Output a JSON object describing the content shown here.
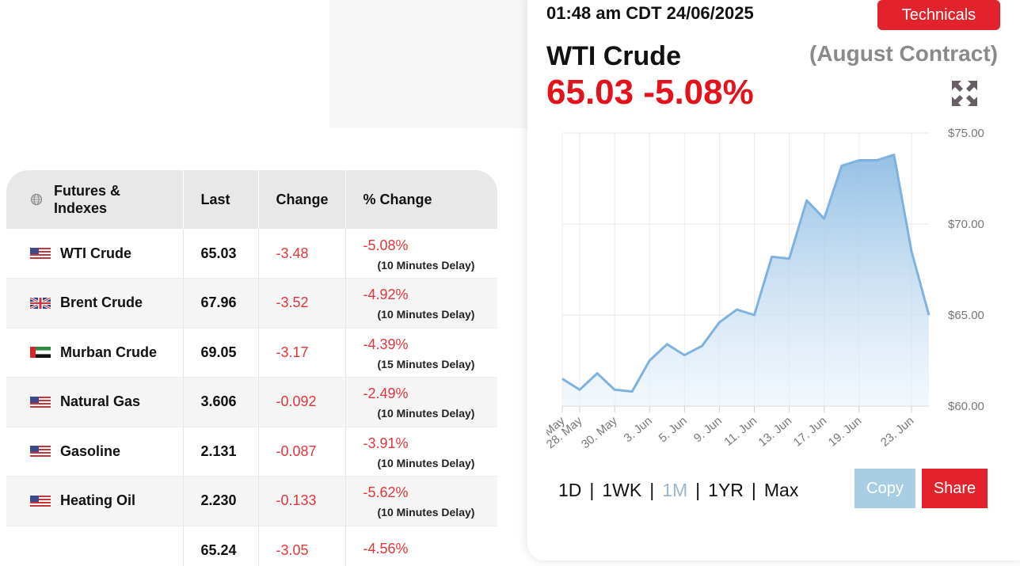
{
  "table": {
    "headers": {
      "name": "Futures & Indexes",
      "last": "Last",
      "change": "Change",
      "pct": "% Change"
    },
    "rows": [
      {
        "flag": "us",
        "name": "WTI Crude",
        "last": "65.03",
        "change": "-3.48",
        "pct": "-5.08%",
        "delay": "(10 Minutes Delay)"
      },
      {
        "flag": "uk",
        "name": "Brent Crude",
        "last": "67.96",
        "change": "-3.52",
        "pct": "-4.92%",
        "delay": "(10 Minutes Delay)"
      },
      {
        "flag": "ae",
        "name": "Murban Crude",
        "last": "69.05",
        "change": "-3.17",
        "pct": "-4.39%",
        "delay": "(15 Minutes Delay)"
      },
      {
        "flag": "us",
        "name": "Natural Gas",
        "last": "3.606",
        "change": "-0.092",
        "pct": "-2.49%",
        "delay": "(10 Minutes Delay)"
      },
      {
        "flag": "us",
        "name": "Gasoline",
        "last": "2.131",
        "change": "-0.087",
        "pct": "-3.91%",
        "delay": "(10 Minutes Delay)"
      },
      {
        "flag": "us",
        "name": "Heating Oil",
        "last": "2.230",
        "change": "-0.133",
        "pct": "-5.62%",
        "delay": "(10 Minutes Delay)"
      },
      {
        "flag": "",
        "name": "",
        "last": "65.24",
        "change": "-3.05",
        "pct": "-4.56%",
        "delay": ""
      }
    ]
  },
  "panel": {
    "timestamp": "01:48 am CDT 24/06/2025",
    "technicals_label": "Technicals",
    "instrument": "WTI Crude",
    "contract": "(August Contract)",
    "price_line": "65.03 -5.08%",
    "expand_icon": "expand-arrows-icon",
    "ranges": [
      "1D",
      "1WK",
      "1M",
      "1YR",
      "Max"
    ],
    "active_range": "1M",
    "copy_label": "Copy",
    "share_label": "Share"
  },
  "colors": {
    "accent_red": "#e2232b",
    "negative": "#e0373a",
    "line": "#7fb2df",
    "copy_bg": "#a9cde3"
  },
  "chart_data": {
    "type": "area",
    "x": [
      "27 May",
      "28 May",
      "29 May",
      "30 May",
      "31 May",
      "2 Jun",
      "3 Jun",
      "4 Jun",
      "5 Jun",
      "6 Jun",
      "9 Jun",
      "10 Jun",
      "11 Jun",
      "12 Jun",
      "13 Jun",
      "16 Jun",
      "17 Jun",
      "18 Jun",
      "19 Jun",
      "20 Jun",
      "23 Jun",
      "24 Jun"
    ],
    "values": [
      61.5,
      60.9,
      61.8,
      60.9,
      60.8,
      62.5,
      63.4,
      62.8,
      63.3,
      64.6,
      65.3,
      65.0,
      68.2,
      68.1,
      71.3,
      70.3,
      73.2,
      73.5,
      73.5,
      73.8,
      68.5,
      65.0
    ],
    "x_tick_labels": [
      "May",
      "28. May",
      "30. May",
      "3. Jun",
      "5. Jun",
      "9. Jun",
      "11. Jun",
      "13. Jun",
      "17. Jun",
      "19. Jun",
      "23. Jun"
    ],
    "y_tick_labels": [
      "$75.00",
      "$70.00",
      "$65.00",
      "$60.00"
    ],
    "ylim": [
      60,
      75
    ],
    "grid": true,
    "y_axis_position": "right"
  }
}
